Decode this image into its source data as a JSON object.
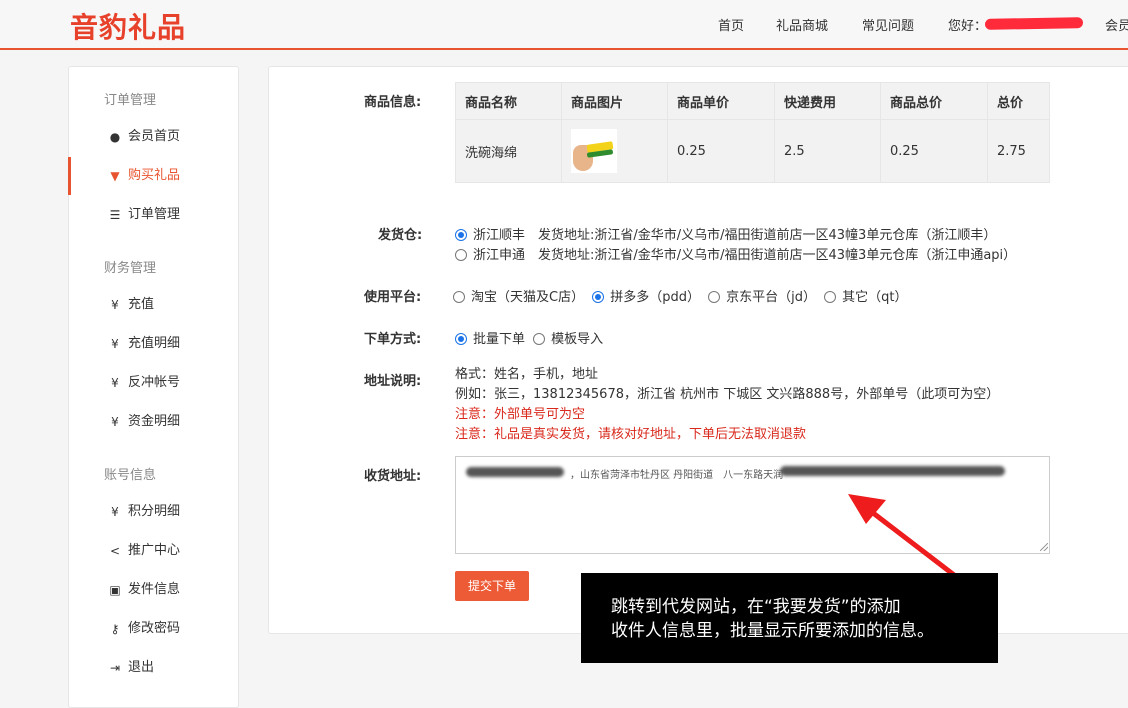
{
  "header": {
    "logo": "音豹礼品",
    "nav": [
      "首页",
      "礼品商城",
      "常见问题",
      "您好：",
      "会员"
    ]
  },
  "sidebar": {
    "groups": [
      {
        "title": "订单管理",
        "items": [
          {
            "icon": "user-circle-icon",
            "glyph": "●",
            "label": "会员首页",
            "active": false
          },
          {
            "icon": "cart-icon",
            "glyph": "🛒",
            "label": "购买礼品",
            "active": true
          },
          {
            "icon": "list-icon",
            "glyph": "☰",
            "label": "订单管理",
            "active": false
          }
        ]
      },
      {
        "title": "财务管理",
        "items": [
          {
            "icon": "yen-icon",
            "glyph": "¥",
            "label": "充值"
          },
          {
            "icon": "yen-icon",
            "glyph": "¥",
            "label": "充值明细"
          },
          {
            "icon": "yen-icon",
            "glyph": "¥",
            "label": "反冲帐号"
          },
          {
            "icon": "yen-icon",
            "glyph": "¥",
            "label": "资金明细"
          }
        ]
      },
      {
        "title": "账号信息",
        "items": [
          {
            "icon": "yen-icon",
            "glyph": "¥",
            "label": "积分明细"
          },
          {
            "icon": "share-icon",
            "glyph": "<",
            "label": "推广中心"
          },
          {
            "icon": "id-card-icon",
            "glyph": "▣",
            "label": "发件信息"
          },
          {
            "icon": "key-icon",
            "glyph": "⚷",
            "label": "修改密码"
          },
          {
            "icon": "logout-icon",
            "glyph": "⇥",
            "label": "退出"
          }
        ]
      }
    ]
  },
  "form": {
    "product_label": "商品信息:",
    "table": {
      "headers": [
        "商品名称",
        "商品图片",
        "商品单价",
        "快递费用",
        "商品总价",
        "总价"
      ],
      "row": {
        "name": "洗碗海绵",
        "unit_price": "0.25",
        "shipping": "2.5",
        "subtotal": "0.25",
        "total": "2.75"
      }
    },
    "warehouse_label": "发货仓:",
    "warehouses": [
      {
        "text": "浙江顺丰　发货地址:浙江省/金华市/义乌市/福田街道前店一区43幢3单元仓库（浙江顺丰）",
        "checked": true
      },
      {
        "text": "浙江申通　发货地址:浙江省/金华市/义乌市/福田街道前店一区43幢3单元仓库（浙江申通api）",
        "checked": false
      }
    ],
    "platform_label": "使用平台:",
    "platforms": [
      {
        "text": "淘宝（天猫及C店）",
        "checked": false
      },
      {
        "text": "拼多多（pdd）",
        "checked": true
      },
      {
        "text": "京东平台（jd）",
        "checked": false
      },
      {
        "text": "其它（qt）",
        "checked": false
      }
    ],
    "order_method_label": "下单方式:",
    "order_methods": [
      {
        "text": "批量下单",
        "checked": true
      },
      {
        "text": "模板导入",
        "checked": false
      }
    ],
    "address_help_label": "地址说明:",
    "address_help": [
      "格式：姓名，手机，地址",
      "例如：张三，13812345678，浙江省 杭州市 下城区 文兴路888号，外部单号（此项可为空）"
    ],
    "address_notes": [
      "注意：外部单号可为空",
      "注意：礼品是真实发货，请核对好地址，下单后无法取消退款"
    ],
    "recipient_label": "收货地址:",
    "recipient_visible_text": "，山东省菏泽市牡丹区 丹阳街道　八一东路天润",
    "submit_label": "提交下单"
  },
  "annotation": {
    "lines": [
      "跳转到代发网站，在“我要发货”的添加",
      "收件人信息里，批量显示所要添加的信息。"
    ]
  },
  "colors": {
    "accent": "#e8542f",
    "logo": "#e8412b",
    "note_red": "#d9281c",
    "radio_blue": "#1a73e8"
  }
}
